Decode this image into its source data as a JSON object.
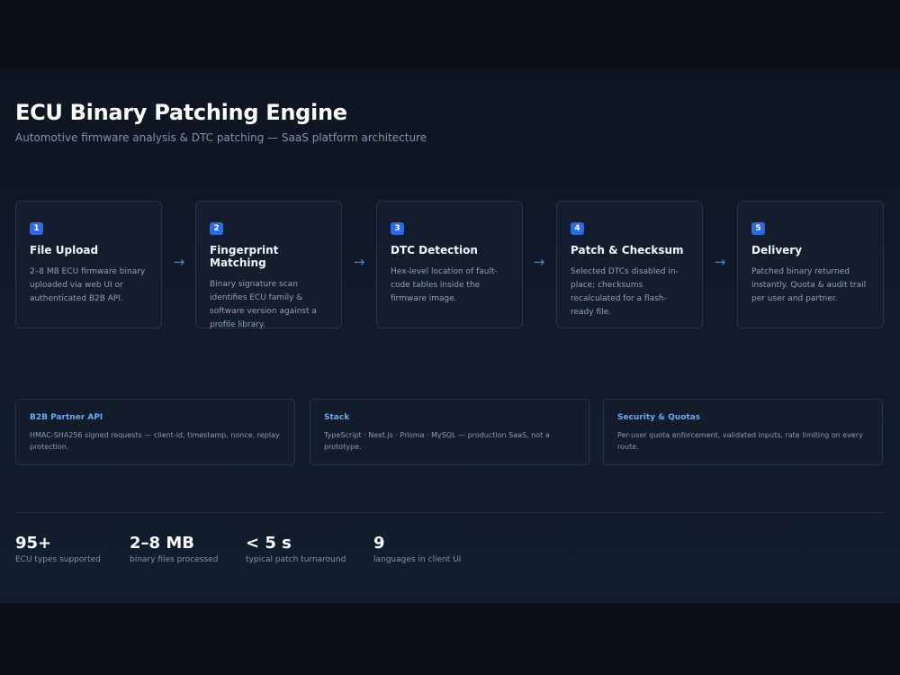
{
  "header": {
    "title": "ECU Binary Patching Engine",
    "subtitle": "Automotive firmware analysis & DTC patching — SaaS platform architecture"
  },
  "pipeline": {
    "arrow_glyph": "→",
    "steps": [
      {
        "number": "1",
        "title": "File Upload",
        "description": "2–8 MB ECU firmware binary uploaded via web UI or authenticated B2B API."
      },
      {
        "number": "2",
        "title": "Fingerprint Matching",
        "description": "Binary signature scan identifies ECU family & software version against a profile library."
      },
      {
        "number": "3",
        "title": "DTC Detection",
        "description": "Hex-level location of fault-code tables inside the firmware image."
      },
      {
        "number": "4",
        "title": "Patch & Checksum",
        "description": "Selected DTCs disabled in-place; checksums recalculated for a flash-ready file."
      },
      {
        "number": "5",
        "title": "Delivery",
        "description": "Patched binary returned instantly. Quota & audit trail per user and partner."
      }
    ]
  },
  "cards": [
    {
      "title": "B2B Partner API",
      "description": "HMAC-SHA256 signed requests — client-id, timestamp, nonce, replay protection."
    },
    {
      "title": "Stack",
      "description": "TypeScript · Next.js · Prisma · MySQL — production SaaS, not a prototype."
    },
    {
      "title": "Security & Quotas",
      "description": "Per-user quota enforcement, validated inputs, rate limiting on every route."
    }
  ],
  "stats": [
    {
      "value": "95+",
      "label": "ECU types supported"
    },
    {
      "value": "2–8 MB",
      "label": "binary files processed"
    },
    {
      "value": "< 5 s",
      "label": "typical patch turnaround"
    },
    {
      "value": "9",
      "label": "languages in client UI"
    }
  ],
  "colors": {
    "accent": "#3b82f6",
    "badge": "#2f6ae5",
    "card_title": "#6ea8ff",
    "background": "#0b0f17"
  }
}
